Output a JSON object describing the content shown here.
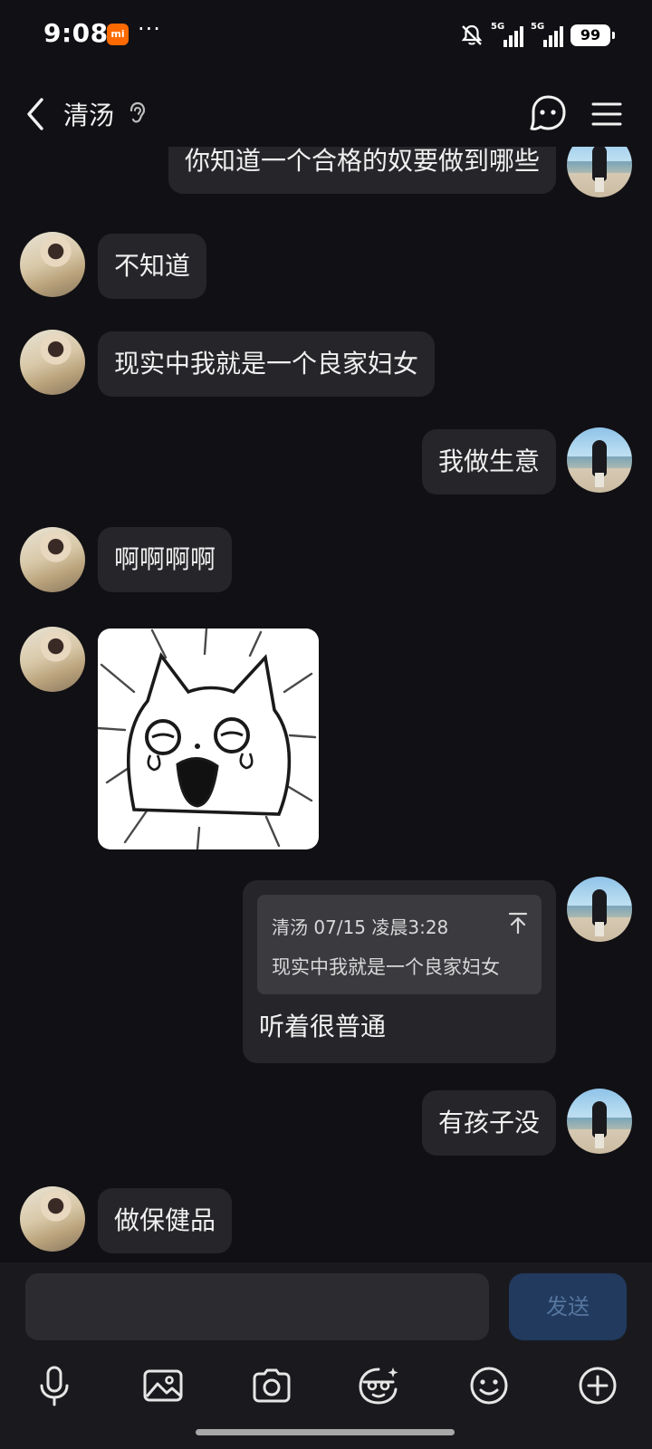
{
  "status_bar": {
    "time": "9:08",
    "carrier_badge": "mi",
    "more": "···",
    "signal1": "5G",
    "signal2": "5G",
    "battery": "99"
  },
  "header": {
    "title": "清汤",
    "icons": [
      "back-arrow-icon",
      "ear-icon",
      "ghost-icon",
      "menu-icon"
    ]
  },
  "messages": [
    {
      "side": "right",
      "text": "你知道一个合格的奴要做到哪些"
    },
    {
      "side": "left",
      "text": "不知道"
    },
    {
      "side": "left",
      "text": "现实中我就是一个良家妇女"
    },
    {
      "side": "right",
      "text": "我做生意"
    },
    {
      "side": "left",
      "text": "啊啊啊啊"
    },
    {
      "side": "left",
      "type": "sticker",
      "sticker": "crying-cat-sticker"
    },
    {
      "side": "right",
      "type": "quote",
      "quote_meta": "清汤 07/15 凌晨3:28",
      "quote_text": "现实中我就是一个良家妇女",
      "text": "听着很普通"
    },
    {
      "side": "right",
      "text": "有孩子没"
    },
    {
      "side": "left",
      "text": "做保健品"
    }
  ],
  "input": {
    "placeholder": "",
    "send_label": "发送"
  },
  "toolbar": [
    "microphone-icon",
    "image-icon",
    "camera-icon",
    "sticker-face-icon",
    "emoji-icon",
    "plus-icon"
  ],
  "colors": {
    "background": "#111014",
    "bubble": "#26262a",
    "send_button": "#213a5e",
    "send_text": "#56759e"
  }
}
